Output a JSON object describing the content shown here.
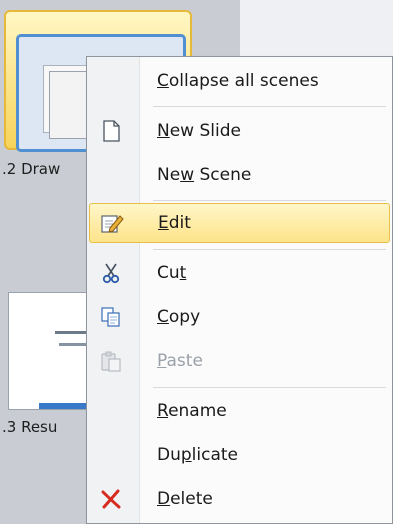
{
  "thumbnails": [
    {
      "label": ".2 Draw"
    },
    {
      "label": ".3 Resu"
    }
  ],
  "context_menu": {
    "items": [
      {
        "pre": "",
        "ul": "C",
        "post": "ollapse all scenes",
        "icon": "",
        "disabled": false
      },
      {
        "pre": "",
        "ul": "N",
        "post": "ew Slide",
        "icon": "new-slide-icon",
        "disabled": false
      },
      {
        "pre": "Ne",
        "ul": "w",
        "post": " Scene",
        "icon": "",
        "disabled": false
      },
      {
        "pre": "",
        "ul": "E",
        "post": "dit",
        "icon": "edit-icon",
        "disabled": false,
        "highlighted": true
      },
      {
        "pre": "Cu",
        "ul": "t",
        "post": "",
        "icon": "cut-icon",
        "disabled": false
      },
      {
        "pre": "",
        "ul": "C",
        "post": "opy",
        "icon": "copy-icon",
        "disabled": false
      },
      {
        "pre": "",
        "ul": "P",
        "post": "aste",
        "icon": "paste-icon",
        "disabled": true
      },
      {
        "pre": "",
        "ul": "R",
        "post": "ename",
        "icon": "",
        "disabled": false
      },
      {
        "pre": "Du",
        "ul": "p",
        "post": "licate",
        "icon": "",
        "disabled": false
      },
      {
        "pre": "",
        "ul": "D",
        "post": "elete",
        "icon": "delete-icon",
        "disabled": false
      }
    ]
  },
  "colors": {
    "highlight": "#fde48a",
    "delete_icon": "#d62b1f",
    "selection_border": "#4f8fd2"
  }
}
